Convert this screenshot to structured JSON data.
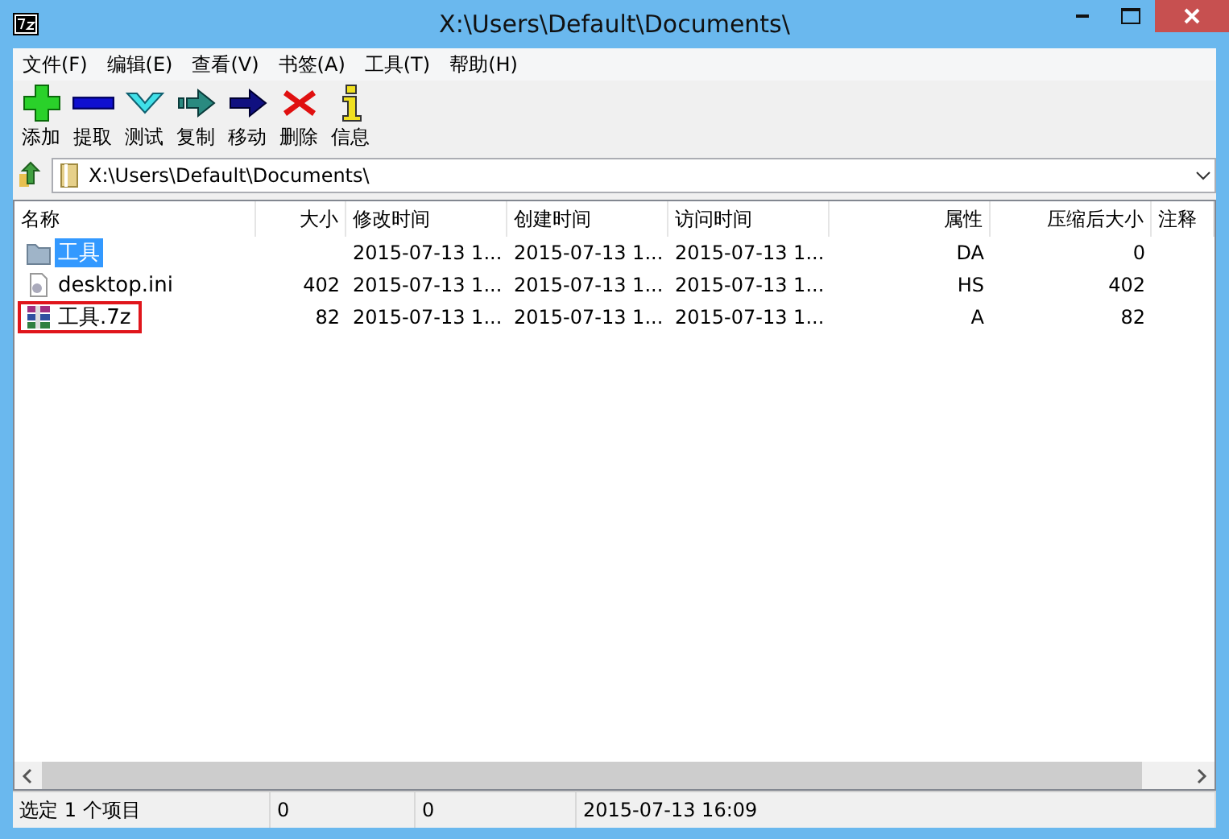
{
  "window": {
    "title": "X:\\Users\\Default\\Documents\\"
  },
  "menu": [
    "文件(F)",
    "编辑(E)",
    "查看(V)",
    "书签(A)",
    "工具(T)",
    "帮助(H)"
  ],
  "toolbar": [
    {
      "kind": "add",
      "label": "添加"
    },
    {
      "kind": "extract",
      "label": "提取"
    },
    {
      "kind": "test",
      "label": "测试"
    },
    {
      "kind": "copy",
      "label": "复制"
    },
    {
      "kind": "move",
      "label": "移动"
    },
    {
      "kind": "delete",
      "label": "删除"
    },
    {
      "kind": "info",
      "label": "信息"
    }
  ],
  "address": {
    "value": "X:\\Users\\Default\\Documents\\"
  },
  "table": {
    "columns": [
      {
        "label": "名称"
      },
      {
        "label": "大小"
      },
      {
        "label": "修改时间"
      },
      {
        "label": "创建时间"
      },
      {
        "label": "访问时间"
      },
      {
        "label": "属性"
      },
      {
        "label": "压缩后大小"
      },
      {
        "label": "注释"
      }
    ],
    "rows": [
      {
        "kind": "folder",
        "selected": true,
        "outlined": false,
        "cells": [
          "工具",
          "",
          "2015-07-13 1...",
          "2015-07-13 1...",
          "2015-07-13 1...",
          "DA",
          "0"
        ]
      },
      {
        "kind": "file",
        "selected": false,
        "outlined": false,
        "cells": [
          "desktop.ini",
          "402",
          "2015-07-13 1...",
          "2015-07-13 1...",
          "2015-07-13 1...",
          "HS",
          "402"
        ]
      },
      {
        "kind": "archive",
        "selected": false,
        "outlined": true,
        "cells": [
          "工具.7z",
          "82",
          "2015-07-13 1...",
          "2015-07-13 1...",
          "2015-07-13 1...",
          "A",
          "82"
        ]
      }
    ]
  },
  "status_bar": [
    "选定 1 个项目",
    "0",
    "0",
    "2015-07-13 16:09"
  ]
}
